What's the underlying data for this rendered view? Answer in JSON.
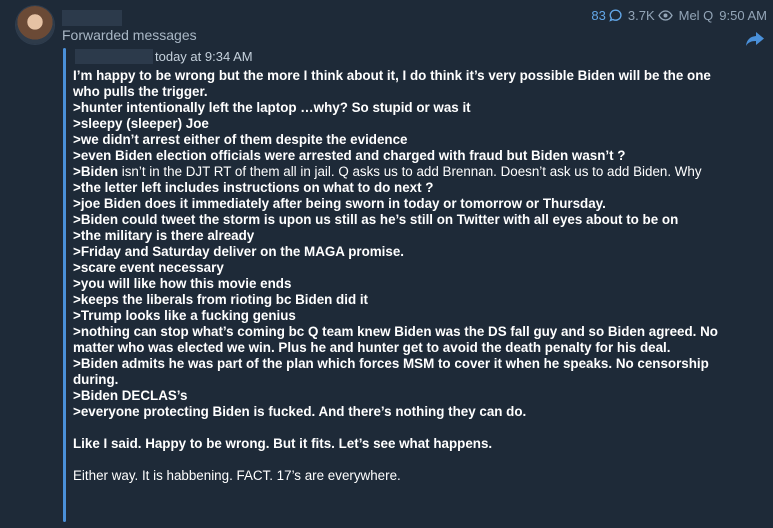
{
  "header": {
    "forwarded_label": "Forwarded messages",
    "comments_count": "83",
    "views_count": "3.7K",
    "author": "Mel Q",
    "time": "9:50 AM",
    "icons": [
      "comment-icon",
      "eye-icon",
      "share-icon"
    ],
    "accent_color": "#62a6e7"
  },
  "quote": {
    "time": "today at 9:34 AM",
    "bar_color": "#4a90d9"
  },
  "message": {
    "l1": "I’m happy to be wrong but the more I think about it, I do think it’s very possible Biden will be the one who pulls the trigger.",
    "l2": ">hunter intentionally left the laptop …why? So stupid or was it",
    "l3": ">sleepy (sleeper) Joe",
    "l4": ">we didn’t arrest either of them despite the evidence",
    "l5": ">even Biden election officials were arrested and charged with fraud but Biden wasn’t ?",
    "l6a": ">Biden",
    "l6b": " isn’t in the DJT RT of them all in jail. Q asks us to add Brennan. Doesn’t ask us to add Biden. Why",
    "l7": ">the letter left includes instructions on what to do next ?",
    "l8": ">joe Biden does it immediately after being sworn in today or tomorrow or Thursday.",
    "l9": ">Biden could tweet the storm is upon us still as he’s still on Twitter with all eyes about to be on",
    "l10": ">the military is there already",
    "l11": ">Friday and Saturday deliver on the MAGA promise.",
    "l12": ">scare event necessary",
    "l13": ">you will like how this movie ends",
    "l14": ">keeps the liberals from rioting bc Biden did it",
    "l15": ">Trump looks like a fucking genius",
    "l16": ">nothing can stop what’s coming bc Q team knew Biden was the DS fall guy and so Biden agreed. No matter who was elected we win. Plus he and hunter get to avoid the death penalty for his deal.",
    "l17": ">Biden admits he was part of the plan which forces MSM to cover it when he speaks. No censorship during.",
    "l18": ">Biden DECLAS’s",
    "l19": ">everyone protecting Biden is fucked. And there’s nothing they can do.",
    "l20": "Like I said. Happy to be wrong. But it fits. Let’s see what happens.",
    "l21": "Either way.  It is habbening. FACT. 17’s are everywhere."
  }
}
